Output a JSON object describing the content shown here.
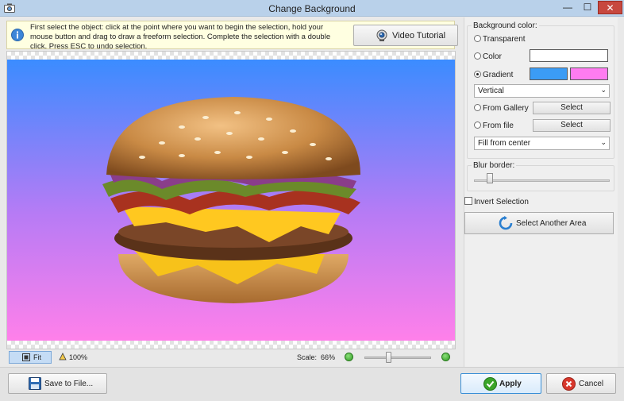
{
  "window": {
    "title": "Change Background",
    "minimize_glyph": "—",
    "maximize_glyph": "☐",
    "close_glyph": "✕"
  },
  "info": {
    "message": "First select the object: click at the point where you want to begin the selection, hold your mouse button and drag to draw a freeform selection. Complete the selection with a double click. Press ESC to undo selection.",
    "video_tutorial_label": "Video Tutorial"
  },
  "background_panel": {
    "title": "Background color:",
    "options": {
      "transparent": "Transparent",
      "color": "Color",
      "gradient": "Gradient",
      "from_gallery": "From Gallery",
      "from_file": "From file"
    },
    "selected_option": "gradient",
    "color_swatch": "#ffffff",
    "gradient_color_1": "#3b9cf5",
    "gradient_color_2": "#ff7cf0",
    "gradient_direction": "Vertical",
    "select_label": "Select",
    "fill_mode": "Fill from center"
  },
  "blur_border": {
    "title": "Blur border:",
    "level": 0.1
  },
  "invert_selection_label": "Invert Selection",
  "invert_selection_checked": false,
  "select_another_area_label": "Select Another Area",
  "status": {
    "fit_label": "Fit",
    "zoom_label": "100%",
    "scale_label": "Scale:",
    "scale_value": "66%",
    "scale_level": 0.66
  },
  "footer": {
    "save_label": "Save to File...",
    "apply_label": "Apply",
    "cancel_label": "Cancel"
  },
  "colors": {
    "gradient_top": "#3b8cff",
    "gradient_bottom": "#ff80ea",
    "accent": "#3a8fd6"
  }
}
